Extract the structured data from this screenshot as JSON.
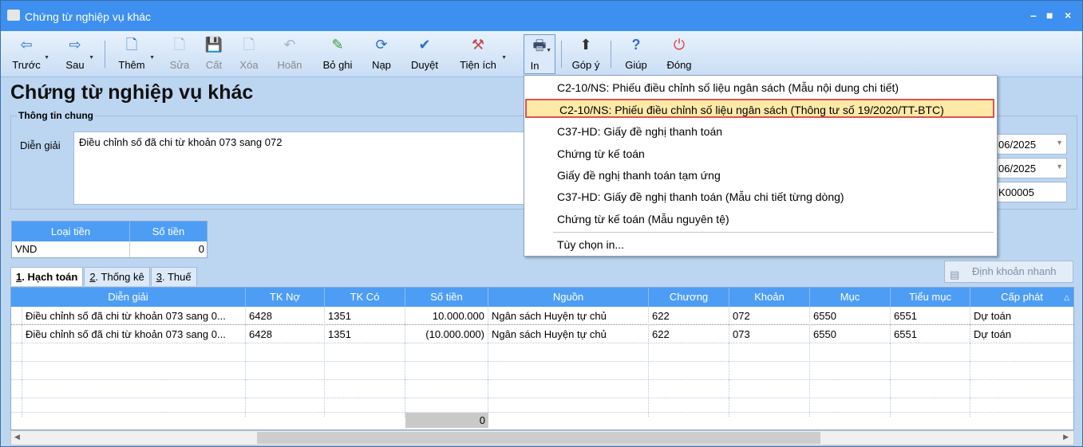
{
  "window": {
    "title": "Chứng từ nghiệp vụ khác",
    "minimize": "–",
    "maximize": "■",
    "close": "×"
  },
  "toolbar": [
    {
      "label": "Trước",
      "icon": "arrow-left-icon",
      "glyph": "⇦"
    },
    {
      "label": "Sau",
      "icon": "arrow-right-icon",
      "glyph": "⇨"
    },
    {
      "label": "Thêm",
      "icon": "new-document-icon",
      "glyph": "🗋"
    },
    {
      "label": "Sửa",
      "icon": "edit-document-icon",
      "glyph": "🗋"
    },
    {
      "label": "Cất",
      "icon": "save-icon",
      "glyph": "💾"
    },
    {
      "label": "Xóa",
      "icon": "delete-document-icon",
      "glyph": "🗋"
    },
    {
      "label": "Hoãn",
      "icon": "undo-icon",
      "glyph": "↶"
    },
    {
      "label": "Bỏ ghi",
      "icon": "unpost-icon",
      "glyph": "✎"
    },
    {
      "label": "Nạp",
      "icon": "refresh-icon",
      "glyph": "⟳"
    },
    {
      "label": "Duyệt",
      "icon": "check-icon",
      "glyph": "✔"
    },
    {
      "label": "Tiện ích",
      "icon": "tools-icon",
      "glyph": "⚒"
    },
    {
      "label": "In",
      "icon": "printer-icon",
      "glyph": "🖶"
    },
    {
      "label": "Góp ý",
      "icon": "feedback-icon",
      "glyph": "⬆"
    },
    {
      "label": "Giúp",
      "icon": "help-icon",
      "glyph": "?"
    },
    {
      "label": "Đóng",
      "icon": "power-icon",
      "glyph": "⏻"
    }
  ],
  "page_title": "Chứng từ nghiệp vụ khác",
  "general": {
    "group_label": "Thông tin chung",
    "dien_giai_label": "Diễn giải",
    "dien_giai_value": "Điều chỉnh số đã chi từ khoản 073 sang 072",
    "date1": "06/2025",
    "date2": "06/2025",
    "ref_no": "K00005"
  },
  "currency": {
    "headers": [
      "Loại tiền",
      "Số tiền"
    ],
    "row": [
      "VND",
      "0"
    ]
  },
  "tabs": [
    {
      "key": "1",
      "label": ". Hạch toán"
    },
    {
      "key": "2",
      "label": ". Thống kê"
    },
    {
      "key": "3",
      "label": ". Thuế"
    }
  ],
  "quick_entry_button": "Định khoản nhanh",
  "grid": {
    "headers": [
      "Diễn giải",
      "TK Nợ",
      "TK Có",
      "Số tiền",
      "Nguồn",
      "Chương",
      "Khoản",
      "Mục",
      "Tiểu mục",
      "Cấp phát"
    ],
    "rows": [
      [
        "Điều chỉnh số đã chi từ khoản 073 sang 0...",
        "6428",
        "1351",
        "10.000.000",
        "Ngân sách Huyện tự chủ",
        "622",
        "072",
        "6550",
        "6551",
        "Dự toán"
      ],
      [
        "Điều chỉnh số đã chi từ khoản 073 sang 0...",
        "6428",
        "1351",
        "(10.000.000)",
        "Ngân sách Huyện tự chủ",
        "622",
        "073",
        "6550",
        "6551",
        "Dự toán"
      ]
    ],
    "total": "0"
  },
  "print_menu": [
    "C2-10/NS: Phiếu điều chỉnh số liệu ngân sách (Mẫu nội dung chi tiết)",
    "C2-10/NS: Phiếu điều chỉnh số liệu ngân sách (Thông tư số 19/2020/TT-BTC)",
    "C37-HD: Giấy đề nghị thanh toán",
    "Chứng từ kế toán",
    "Giấy đề nghị thanh toán tạm ứng",
    "C37-HD: Giấy đề nghị thanh toán (Mẫu chi tiết từng dòng)",
    "Chứng từ kế toán (Mẫu nguyên tệ)",
    "Tùy chọn in..."
  ],
  "colors": {
    "title_bar": "#3d8ff0",
    "grid_header": "#4d9df5",
    "highlight_border": "#e05050",
    "highlight_fill": "#ffe9a6"
  }
}
